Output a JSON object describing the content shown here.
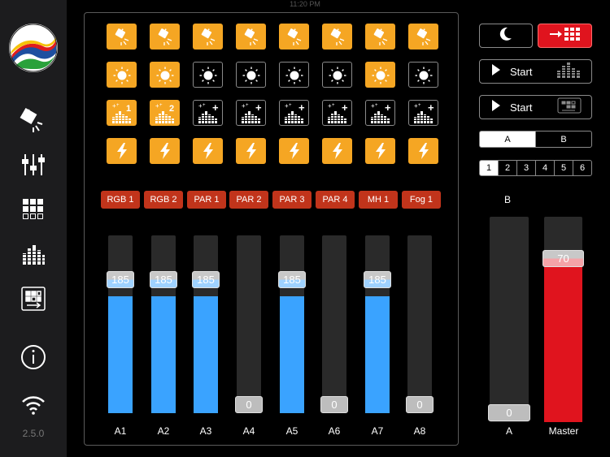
{
  "status_bar": {
    "time": "11:20 PM"
  },
  "app": {
    "version": "2.5.0"
  },
  "colors": {
    "accent_orange": "#f5a623",
    "channel_red": "#c1341b",
    "fader_blue": "#3aa3ff",
    "master_red": "#e0141e"
  },
  "sidebar": {
    "items": [
      {
        "name": "fixtures-icon"
      },
      {
        "name": "mixer-sliders-icon"
      },
      {
        "name": "scene-grid-icon"
      },
      {
        "name": "sound-levels-icon"
      },
      {
        "name": "chase-icon"
      },
      {
        "name": "info-icon"
      },
      {
        "name": "wifi-icon"
      }
    ]
  },
  "grid": {
    "row1": [
      true,
      true,
      true,
      true,
      true,
      true,
      true,
      true
    ],
    "row2": [
      true,
      true,
      false,
      false,
      false,
      false,
      true,
      false
    ],
    "row3_labels": [
      "1",
      "2",
      "+",
      "+",
      "+",
      "+",
      "+",
      "+"
    ],
    "row3": [
      true,
      true,
      false,
      false,
      false,
      false,
      false,
      false
    ],
    "row4": [
      true,
      true,
      true,
      true,
      true,
      true,
      true,
      true
    ]
  },
  "channels": [
    "RGB 1",
    "RGB 2",
    "PAR 1",
    "PAR 2",
    "PAR 3",
    "PAR 4",
    "MH 1",
    "Fog 1"
  ],
  "faders": [
    {
      "label": "A1",
      "value": "185",
      "level": 0.725
    },
    {
      "label": "A2",
      "value": "185",
      "level": 0.725
    },
    {
      "label": "A3",
      "value": "185",
      "level": 0.725
    },
    {
      "label": "A4",
      "value": "0",
      "level": 0
    },
    {
      "label": "A5",
      "value": "185",
      "level": 0.725
    },
    {
      "label": "A6",
      "value": "0",
      "level": 0
    },
    {
      "label": "A7",
      "value": "185",
      "level": 0.725
    },
    {
      "label": "A8",
      "value": "0",
      "level": 0
    }
  ],
  "right": {
    "blackout_icon": "moon-icon",
    "scene_icon": "arrow-grid-icon",
    "start1": {
      "label": "Start",
      "icon": "sound-bars-icon"
    },
    "start2": {
      "label": "Start",
      "icon": "chase-icon"
    },
    "ab_tabs": [
      "A",
      "B"
    ],
    "ab_selected": "A",
    "pages": [
      "1",
      "2",
      "3",
      "4",
      "5",
      "6"
    ],
    "page_selected": "1",
    "crossfader_top": "B",
    "crossfader": {
      "label": "A",
      "value": "0",
      "level": 0
    },
    "master": {
      "label": "Master",
      "value": "70",
      "level": 0.79
    }
  }
}
